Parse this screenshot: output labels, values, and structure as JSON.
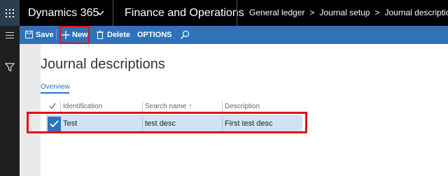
{
  "header": {
    "product": "Dynamics 365",
    "module": "Finance and Operations",
    "breadcrumbs": [
      "General ledger",
      "Journal setup",
      "Journal descriptions"
    ]
  },
  "icons": {
    "app_launcher": "waffle-icon",
    "product_menu": "chevron-down-icon",
    "rail_menu": "hamburger-icon",
    "rail_filter": "filter-icon",
    "save": "save-icon",
    "new": "plus-icon",
    "delete": "trash-icon",
    "search": "search-icon"
  },
  "toolbar": {
    "save_label": "Save",
    "new_label": "New",
    "delete_label": "Delete",
    "options_label": "OPTIONS"
  },
  "page": {
    "title": "Journal descriptions",
    "tab": "Overview"
  },
  "grid": {
    "columns": [
      "Identification",
      "Search name ↑",
      "Description"
    ],
    "rows": [
      {
        "identification": "Test",
        "search_name": "test desc",
        "description": "First test desc",
        "selected": true
      }
    ]
  },
  "colors": {
    "topbar": "#000000",
    "actionbar": "#2e73ba",
    "selected_row": "#cfe3f4",
    "highlight": "#e0101b"
  }
}
